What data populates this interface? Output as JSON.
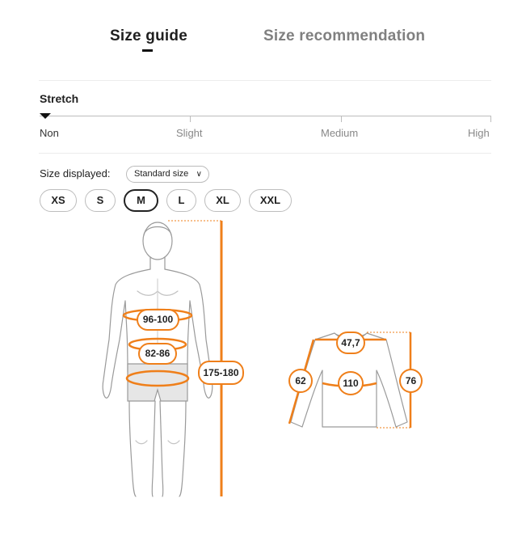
{
  "tabs": {
    "guide": "Size guide",
    "recommendation": "Size recommendation"
  },
  "stretch": {
    "title": "Stretch",
    "levels": [
      "Non",
      "Slight",
      "Medium",
      "High"
    ],
    "selected": "Non"
  },
  "size_display": {
    "label": "Size displayed:",
    "value": "Standard size"
  },
  "sizes": [
    "XS",
    "S",
    "M",
    "L",
    "XL",
    "XXL"
  ],
  "selected_size": "M",
  "body_measurements": {
    "chest": "96-100",
    "waist": "82-86",
    "height": "175-180"
  },
  "garment_measurements": {
    "shoulder": "47,7",
    "sleeve": "62",
    "chest": "110",
    "length": "76"
  },
  "colors": {
    "accent": "#ef7f1a",
    "outline": "#9a9a9a",
    "text": "#222222"
  }
}
